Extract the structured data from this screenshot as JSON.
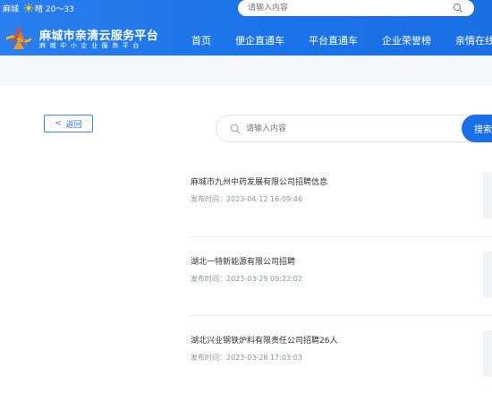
{
  "topbar": {
    "city": "麻城",
    "weather_icon": "sun-icon",
    "weather": "晴 20～33",
    "search_placeholder": "请输入内容"
  },
  "header": {
    "title": "麻城市亲清云服务平台",
    "subtitle": "麻城中小企业服务平台",
    "nav": [
      "首页",
      "便企直通车",
      "平台直通车",
      "企业荣誉榜",
      "亲情在线"
    ]
  },
  "content": {
    "back_label": "返回",
    "search_placeholder": "请输入内容",
    "search_button": "搜索"
  },
  "news": [
    {
      "title": "麻城市九州中药发展有限公司招聘信息",
      "date_prefix": "发布时间：",
      "date": "2023-04-12 16:09:46"
    },
    {
      "title": "湖北一特新能源有限公司招聘",
      "date_prefix": "发布时间：",
      "date": "2023-03-29 09:22:02"
    },
    {
      "title": "湖北兴业钢铁炉料有限责任公司招聘26人",
      "date_prefix": "发布时间：",
      "date": "2023-03-28 17:03:03"
    }
  ],
  "colors": {
    "brand": "#1a73e8",
    "band": "#f4f6f8",
    "accent_button": "#1b6fe8"
  }
}
